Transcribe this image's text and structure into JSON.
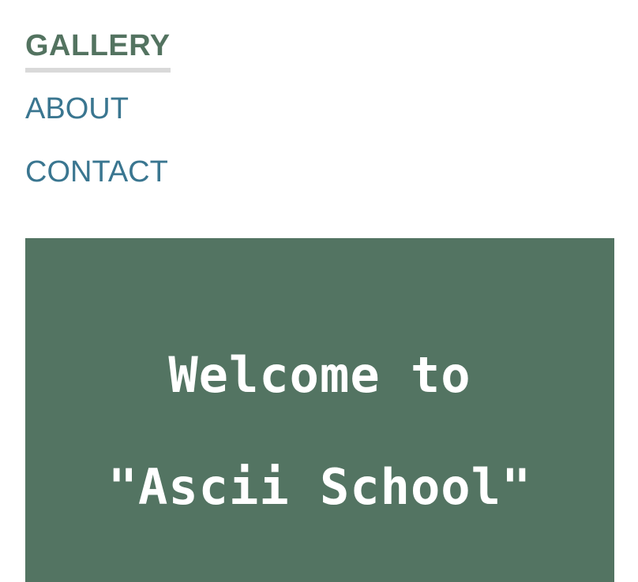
{
  "nav": {
    "items": [
      {
        "label": "GALLERY",
        "active": true
      },
      {
        "label": "ABOUT",
        "active": false
      },
      {
        "label": "CONTACT",
        "active": false
      }
    ]
  },
  "hero": {
    "line1": "Welcome to",
    "line2": "\"Ascii School\"",
    "background_color": "#537462",
    "text_color": "#ffffff"
  },
  "colors": {
    "active_nav": "#537360",
    "nav_link": "#3a7690",
    "active_underline": "#d9d9d9"
  }
}
